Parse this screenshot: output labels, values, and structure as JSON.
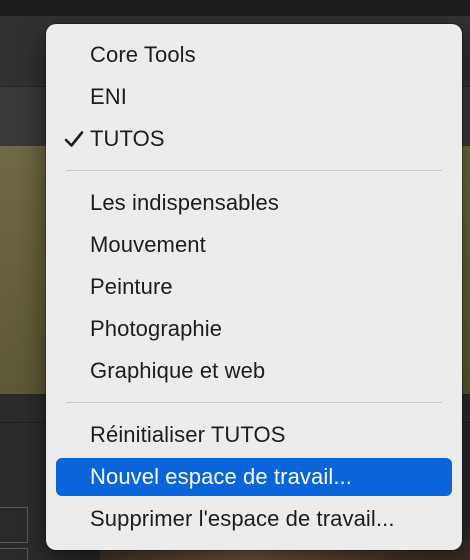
{
  "menu": {
    "group_workspaces": [
      {
        "label": "Core Tools",
        "checked": false
      },
      {
        "label": "ENI",
        "checked": false
      },
      {
        "label": "TUTOS",
        "checked": true
      }
    ],
    "group_presets": [
      {
        "label": "Les indispensables"
      },
      {
        "label": "Mouvement"
      },
      {
        "label": "Peinture"
      },
      {
        "label": "Photographie"
      },
      {
        "label": "Graphique et web"
      }
    ],
    "group_actions": [
      {
        "label": "Réinitialiser TUTOS",
        "selected": false
      },
      {
        "label": "Nouvel espace de travail...",
        "selected": true
      },
      {
        "label": "Supprimer l'espace de travail...",
        "selected": false
      }
    ]
  },
  "colors": {
    "menu_background": "#ececec",
    "selection_accent": "#0a64da",
    "separator": "#c9c9c9",
    "text": "#1d1d1d"
  },
  "icons": {
    "checkmark": "checkmark-icon"
  }
}
